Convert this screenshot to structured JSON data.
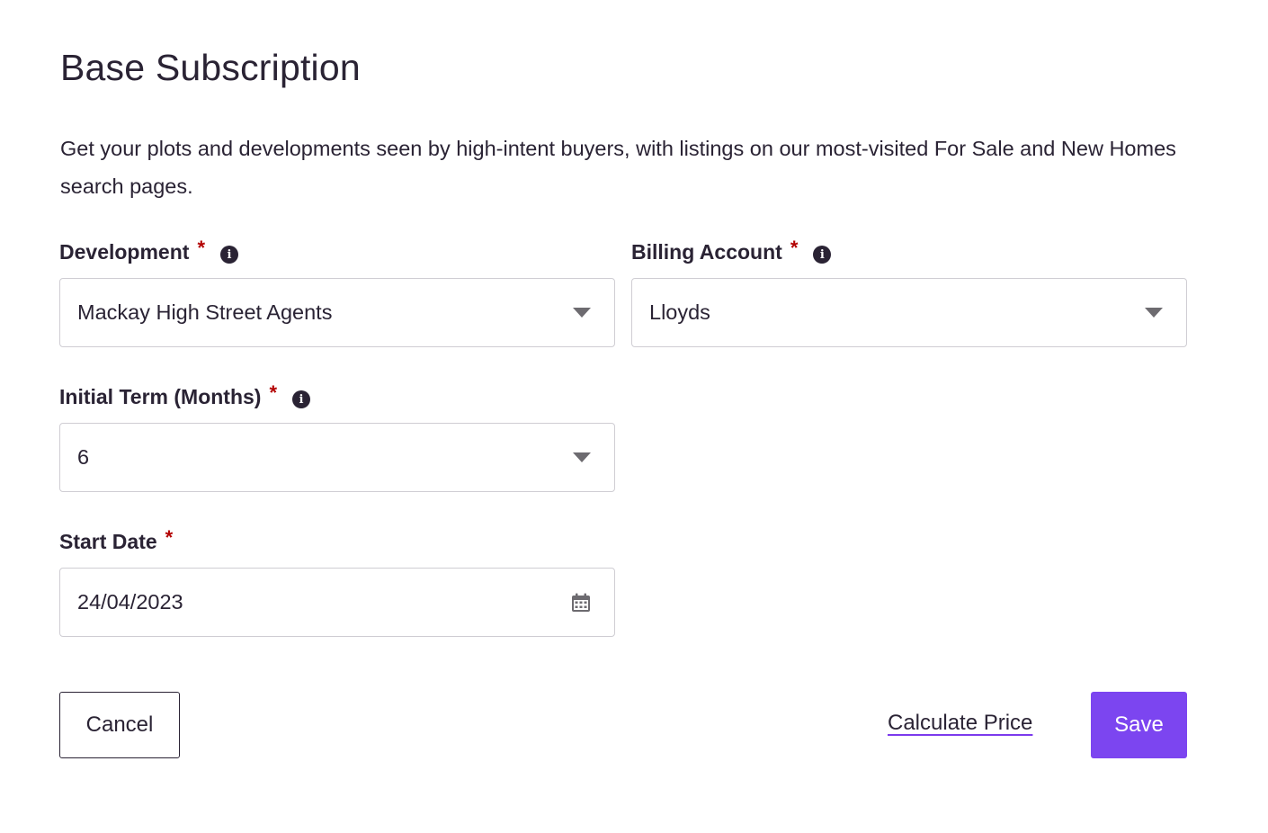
{
  "page": {
    "title": "Base Subscription",
    "description": "Get your plots and developments seen by high-intent buyers, with listings on our most-visited For Sale and New Homes search pages."
  },
  "fields": {
    "development": {
      "label": "Development",
      "required": "*",
      "value": "Mackay High Street Agents"
    },
    "billing_account": {
      "label": "Billing Account",
      "required": "*",
      "value": "Lloyds"
    },
    "initial_term": {
      "label": "Initial Term (Months)",
      "required": "*",
      "value": "6"
    },
    "start_date": {
      "label": "Start Date",
      "required": "*",
      "value": "24/04/2023"
    }
  },
  "icons": {
    "info": "info-icon",
    "dropdown": "chevron-down-icon",
    "calendar": "calendar-icon"
  },
  "actions": {
    "cancel_label": "Cancel",
    "calculate_label": "Calculate Price",
    "save_label": "Save"
  },
  "colors": {
    "accent": "#7c45f0",
    "required": "#b30000",
    "text": "#2a2334",
    "border": "#cfcdd3"
  }
}
